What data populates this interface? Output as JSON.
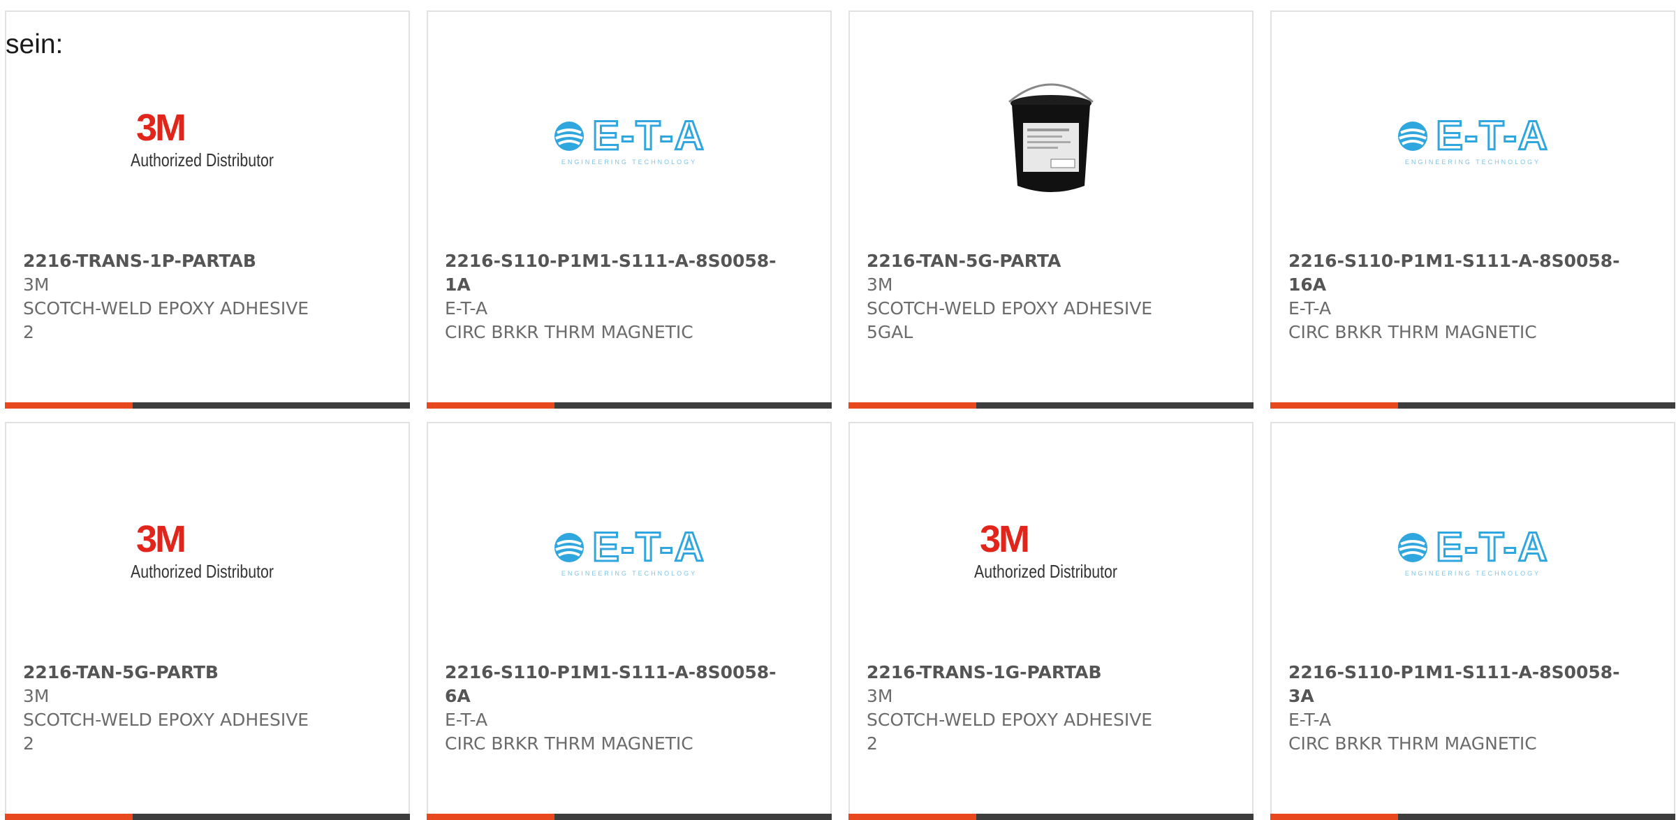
{
  "intro_text": "sein:",
  "colors": {
    "accent": "#e8481d",
    "bar": "#3d3d3d",
    "brand_3m": "#e1251b",
    "brand_eta": "#2fa6dd"
  },
  "cards": [
    {
      "part": "2216-TRANS-1P-PARTAB",
      "maker": "3M",
      "desc": "SCOTCH-WELD EPOXY ADHESIVE",
      "extra": "2",
      "logo": "3m-logo"
    },
    {
      "part": "2216-S110-P1M1-S111-A-8S0058-1A",
      "maker": "E-T-A",
      "desc": "CIRC BRKR THRM MAGNETIC",
      "extra": "",
      "logo": "eta-logo"
    },
    {
      "part": "2216-TAN-5G-PARTA",
      "maker": "3M",
      "desc": "SCOTCH-WELD EPOXY ADHESIVE",
      "extra": "5GAL",
      "logo": "bucket-image"
    },
    {
      "part": "2216-S110-P1M1-S111-A-8S0058-16A",
      "maker": "E-T-A",
      "desc": "CIRC BRKR THRM MAGNETIC",
      "extra": "",
      "logo": "eta-logo"
    },
    {
      "part": "2216-TAN-5G-PARTB",
      "maker": "3M",
      "desc": "SCOTCH-WELD EPOXY ADHESIVE",
      "extra": "2",
      "logo": "3m-logo"
    },
    {
      "part": "2216-S110-P1M1-S111-A-8S0058-6A",
      "maker": "E-T-A",
      "desc": "CIRC BRKR THRM MAGNETIC",
      "extra": "",
      "logo": "eta-logo"
    },
    {
      "part": "2216-TRANS-1G-PARTAB",
      "maker": "3M",
      "desc": "SCOTCH-WELD EPOXY ADHESIVE",
      "extra": "2",
      "logo": "3m-logo"
    },
    {
      "part": "2216-S110-P1M1-S111-A-8S0058-3A",
      "maker": "E-T-A",
      "desc": "CIRC BRKR THRM MAGNETIC",
      "extra": "",
      "logo": "eta-logo"
    }
  ],
  "logos": {
    "three_m": {
      "mark": "3M",
      "sub": "Authorized Distributor"
    },
    "eta": {
      "word": "E-T-A",
      "tag": "ENGINEERING TECHNOLOGY"
    }
  }
}
